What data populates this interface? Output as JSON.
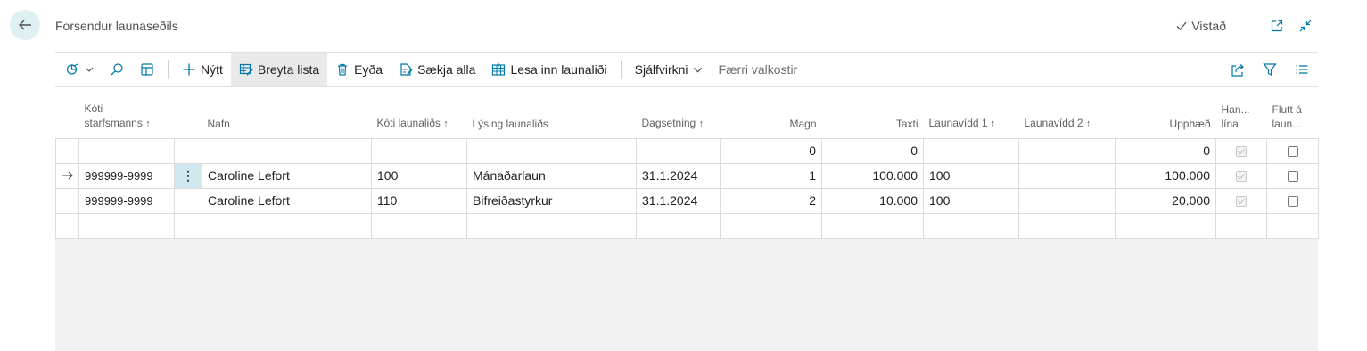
{
  "header": {
    "title": "Forsendur launaseðils",
    "saved_label": "Vistað"
  },
  "toolbar": {
    "new_label": "Nýtt",
    "edit_list_label": "Breyta lista",
    "delete_label": "Eyða",
    "fetch_all_label": "Sækja alla",
    "import_label": "Lesa inn launaliði",
    "automation_label": "Sjálfvirkni",
    "fewer_options_label": "Færri valkostir"
  },
  "table": {
    "columns": {
      "employee_code_1": "Kóti",
      "employee_code_2": "starfsmanns",
      "name": "Nafn",
      "pay_item_code": "Kóti launaliðs",
      "pay_item_desc": "Lýsing launaliðs",
      "date": "Dagsetning",
      "quantity": "Magn",
      "rate": "Taxti",
      "dim1": "Launavídd 1",
      "dim2": "Launavídd 2",
      "amount": "Upphæð",
      "manual_1": "Han...",
      "manual_2": "lína",
      "moved_1": "Flutt á",
      "moved_2": "laun..."
    },
    "sort_arrow": "↑",
    "totals": {
      "quantity": "0",
      "rate": "0",
      "amount": "0"
    },
    "rows": [
      {
        "employee_code": "999999-9999",
        "name": "Caroline Lefort",
        "pay_item_code": "100",
        "pay_item_desc": "Mánaðarlaun",
        "date": "31.1.2024",
        "quantity": "1",
        "rate": "100.000",
        "dim1": "100",
        "dim2": "",
        "amount": "100.000"
      },
      {
        "employee_code": "999999-9999",
        "name": "Caroline Lefort",
        "pay_item_code": "110",
        "pay_item_desc": "Bifreiðastyrkur",
        "date": "31.1.2024",
        "quantity": "2",
        "rate": "10.000",
        "dim1": "100",
        "dim2": "",
        "amount": "20.000"
      }
    ]
  },
  "icons": {
    "back": "back-arrow-icon",
    "check": "checkmark-icon",
    "popout": "open-new-window-icon",
    "collapse": "collapse-icon",
    "views": "analysis-views-icon",
    "search": "search-icon",
    "layout": "layout-icon",
    "share": "share-icon",
    "filter": "filter-icon",
    "list": "list-view-icon"
  },
  "colors": {
    "accent": "#dff0f2",
    "active_button": "#e9e9e9",
    "selected_cell": "#cfe9ee",
    "empty_area": "#f2f2f2"
  }
}
